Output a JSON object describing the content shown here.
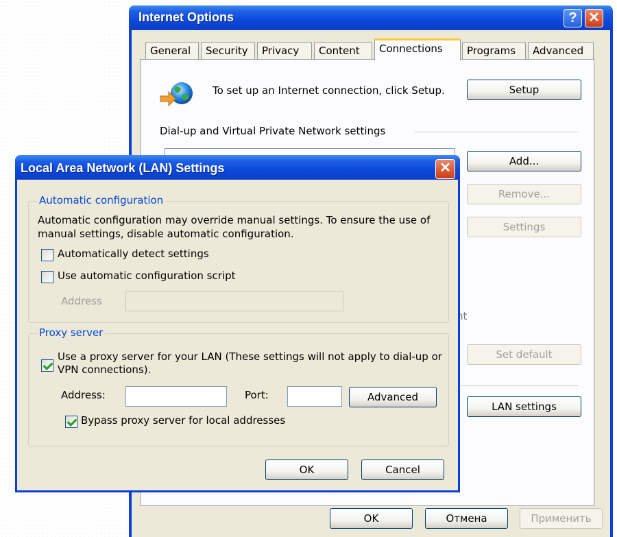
{
  "internet_options": {
    "title": "Internet Options",
    "tabs": [
      {
        "label": "General"
      },
      {
        "label": "Security"
      },
      {
        "label": "Privacy"
      },
      {
        "label": "Content"
      },
      {
        "label": "Connections"
      },
      {
        "label": "Programs"
      },
      {
        "label": "Advanced"
      }
    ],
    "active_tab": "Connections",
    "setup_text": "To set up an Internet connection, click Setup.",
    "setup_button": "Setup",
    "dialup_section": "Dial-up and Virtual Private Network settings",
    "add_button": "Add...",
    "remove_button": "Remove...",
    "settings_button": "Settings",
    "partial_text": "nt",
    "set_default_button": "Set default",
    "lan_settings_button": "LAN settings",
    "ok_button": "OK",
    "cancel_button": "Отмена",
    "apply_button": "Применить"
  },
  "lan_dialog": {
    "title": "Local Area Network (LAN) Settings",
    "auto_config": {
      "legend": "Automatic configuration",
      "description": "Automatic configuration may override manual settings.  To ensure the use of manual settings, disable automatic configuration.",
      "auto_detect_label": "Automatically detect settings",
      "auto_detect_checked": false,
      "script_label": "Use automatic configuration script",
      "script_checked": false,
      "address_label": "Address",
      "address_value": ""
    },
    "proxy": {
      "legend": "Proxy server",
      "use_proxy_label": "Use a proxy server for your LAN (These settings will not apply to dial-up or VPN connections).",
      "use_proxy_checked": true,
      "address_label": "Address:",
      "address_value": "",
      "port_label": "Port:",
      "port_value": "",
      "advanced_button": "Advanced",
      "bypass_label": "Bypass proxy server for local addresses",
      "bypass_checked": true
    },
    "ok_button": "OK",
    "cancel_button": "Cancel"
  }
}
